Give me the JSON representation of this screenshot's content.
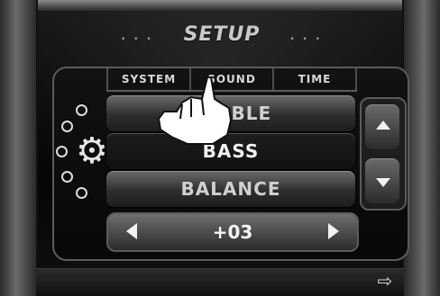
{
  "header": {
    "title": "SETUP",
    "left_dots": "• • •",
    "right_dots": "• • •"
  },
  "tabs": [
    {
      "label": "SYSTEM"
    },
    {
      "label": "SOUND"
    },
    {
      "label": "TIME"
    }
  ],
  "list": {
    "items": [
      {
        "label": "TREBLE"
      },
      {
        "label": "BASS"
      },
      {
        "label": "BALANCE"
      }
    ]
  },
  "value_bar": {
    "value": "+03"
  },
  "icons": {
    "gear": "gear-icon",
    "scroll_up": "triangle-up-icon",
    "scroll_down": "triangle-down-icon",
    "decrease": "arrow-left-icon",
    "increase": "arrow-right-icon",
    "exit": "exit-icon",
    "hand": "hand-pointer-icon"
  },
  "colors": {
    "accent": "#cfcfcf",
    "panel_border": "#5b5b5b",
    "background": "#0a0a0a"
  }
}
